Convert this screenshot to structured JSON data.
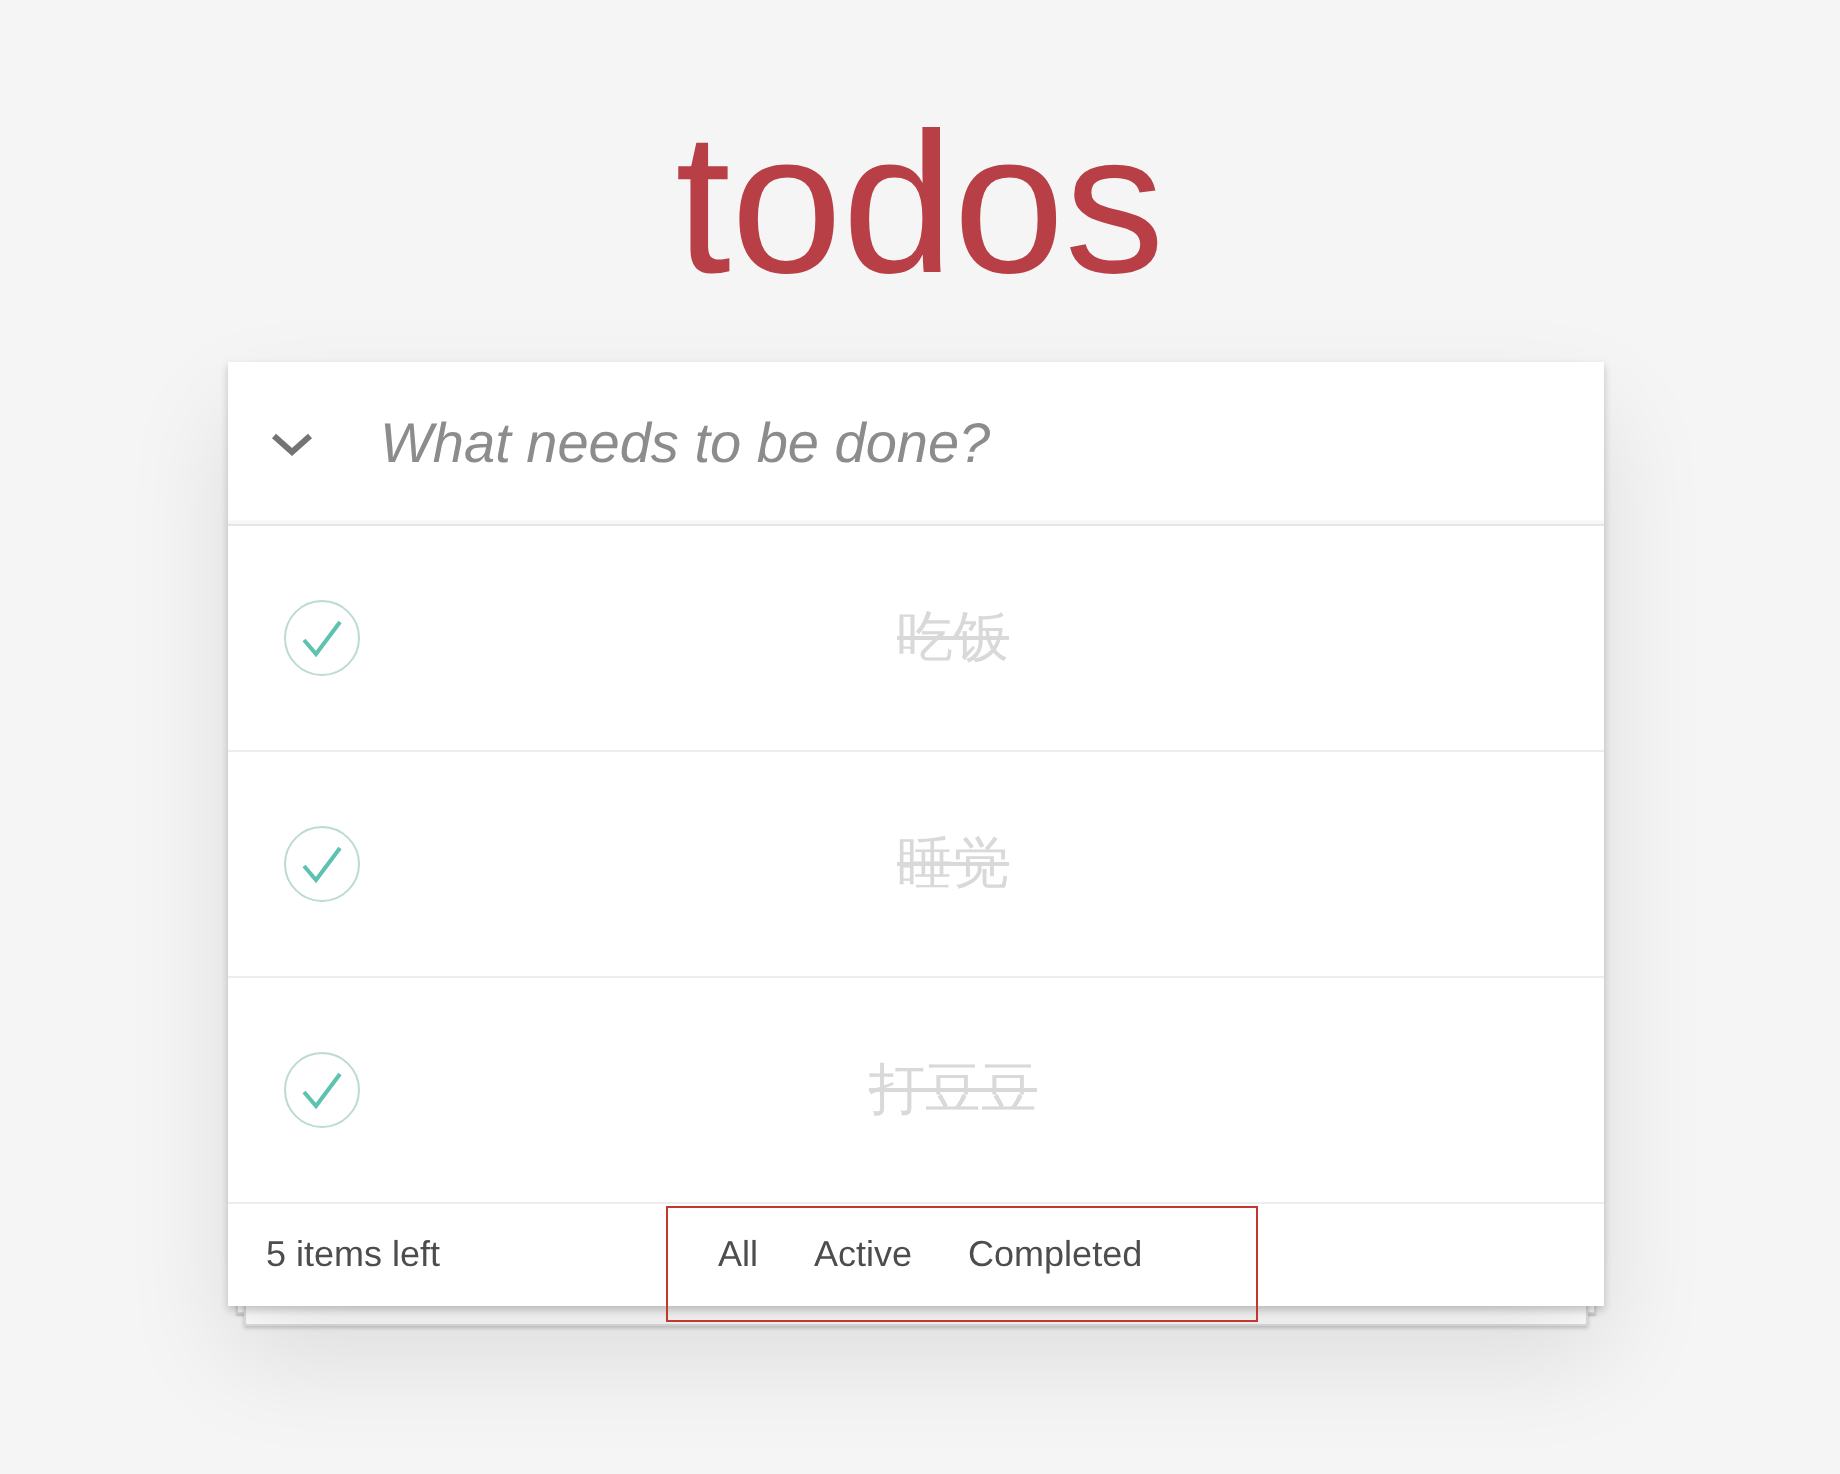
{
  "title": "todos",
  "new_todo": {
    "placeholder": "What needs to be done?"
  },
  "todos": [
    {
      "text": "吃饭",
      "completed": true
    },
    {
      "text": "睡觉",
      "completed": true
    },
    {
      "text": "打豆豆",
      "completed": true
    }
  ],
  "footer": {
    "count": "5 items left",
    "filters": [
      {
        "label": "All",
        "selected": false
      },
      {
        "label": "Active",
        "selected": false
      },
      {
        "label": "Completed",
        "selected": false
      }
    ]
  }
}
